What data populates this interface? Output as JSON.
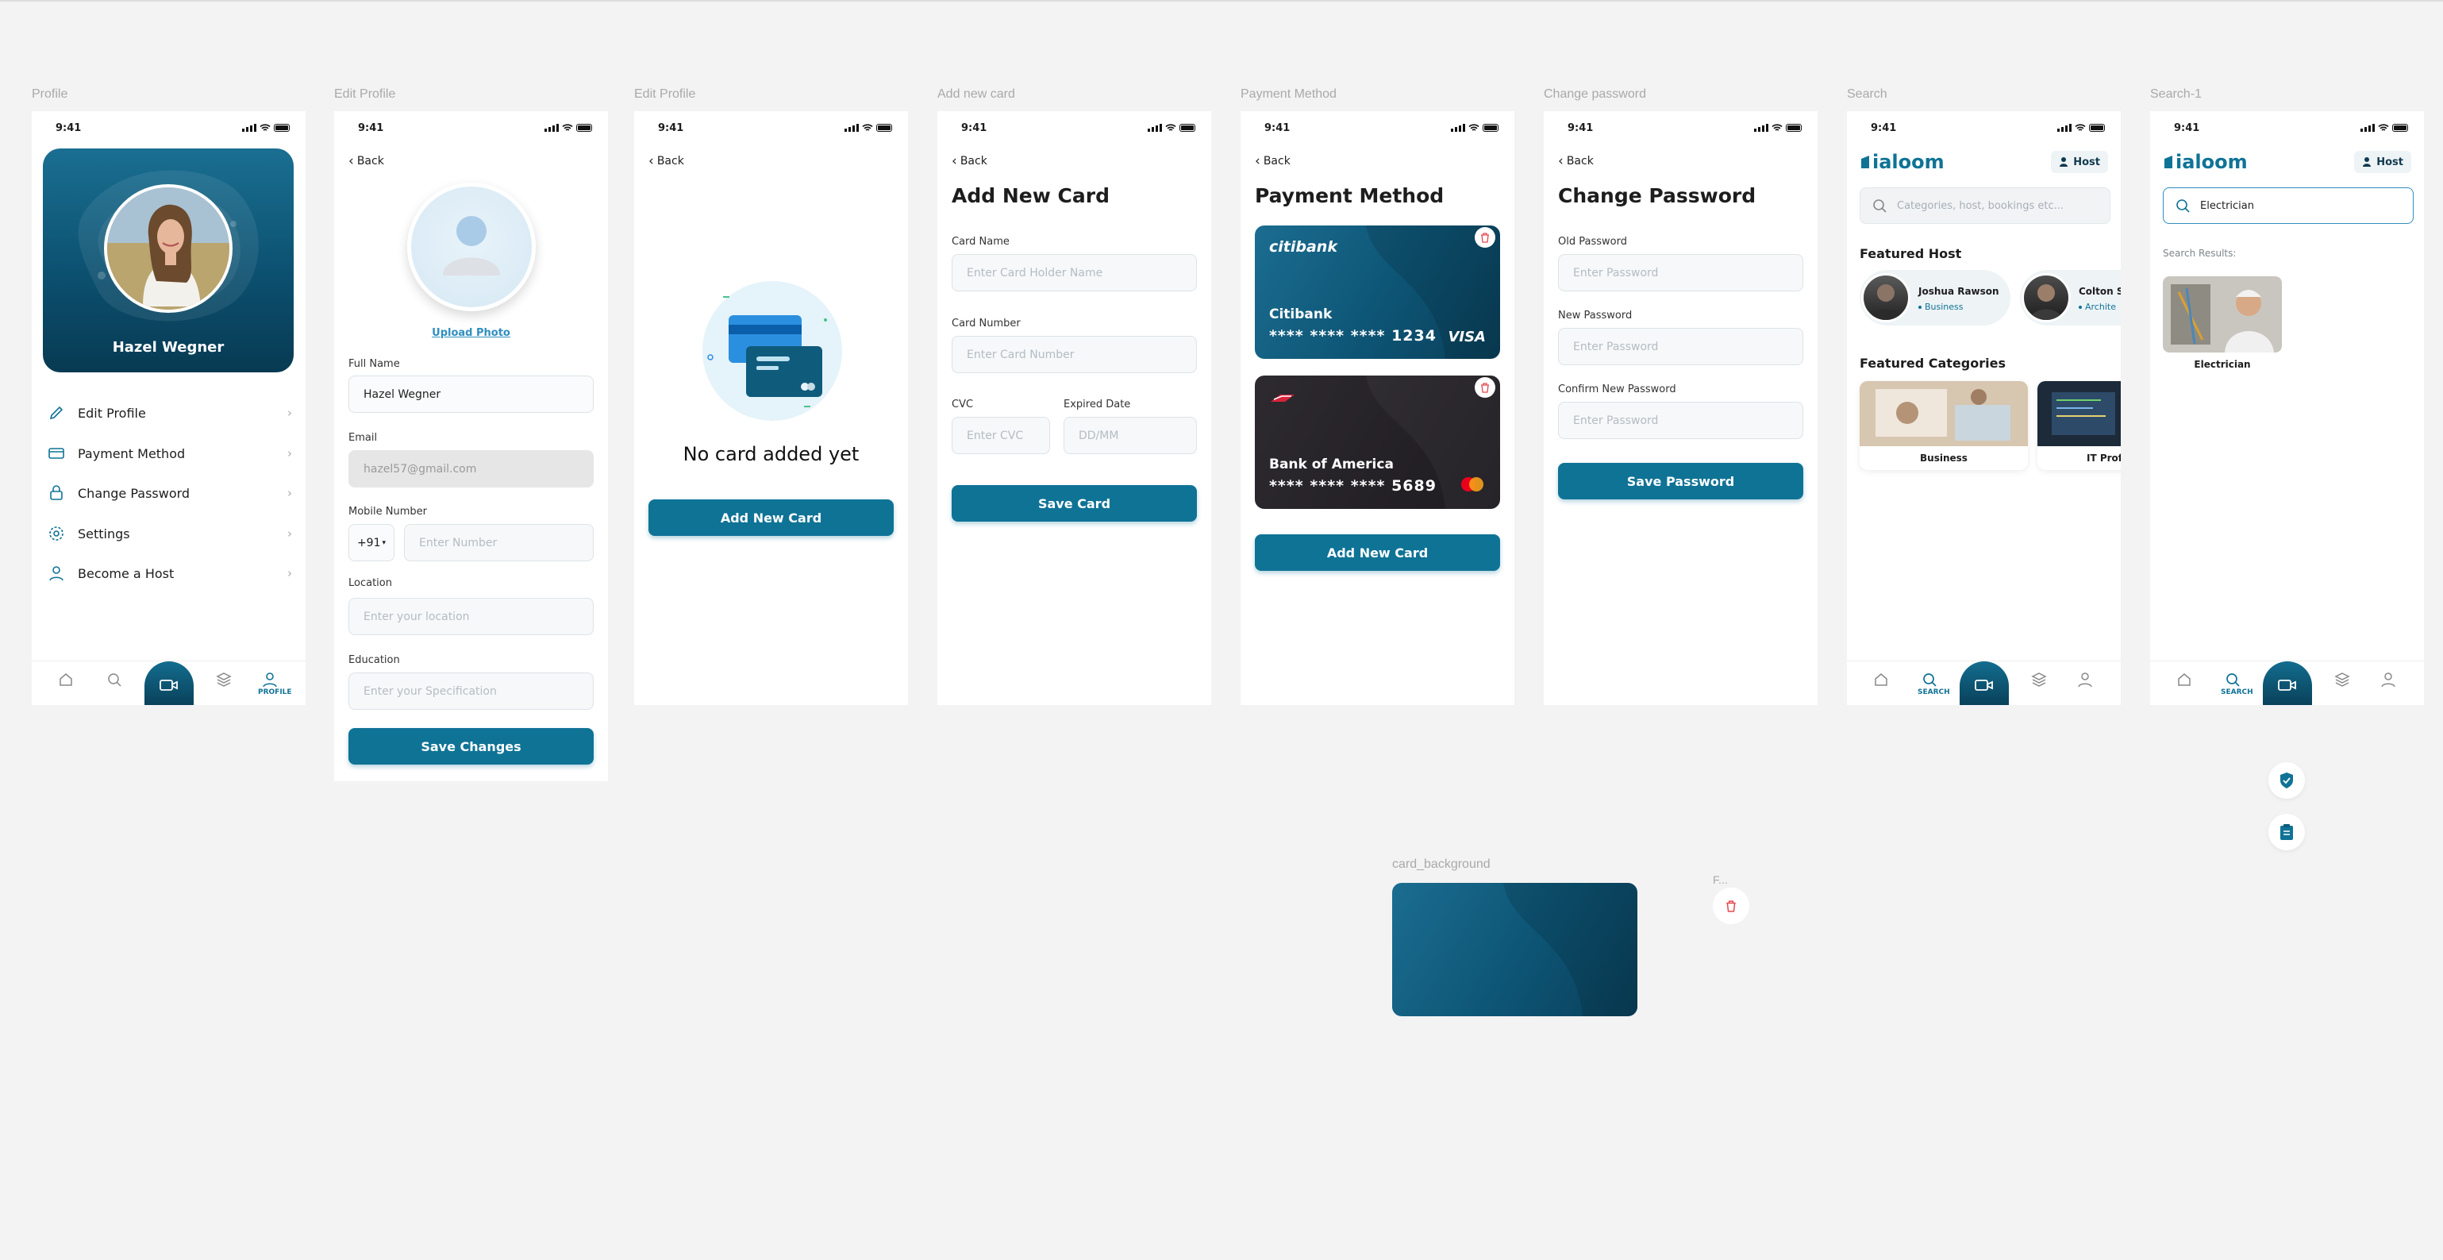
{
  "status": {
    "time": "9:41"
  },
  "frames": {
    "profile": "Profile",
    "edit_profile": "Edit Profile",
    "edit_profile_2": "Edit Profile",
    "add_new_card": "Add new card",
    "payment_method": "Payment Method",
    "change_password": "Change password",
    "search": "Search",
    "search_1": "Search-1",
    "card_background": "card_background",
    "f": "F..."
  },
  "profile": {
    "name": "Hazel Wegner",
    "menu": [
      {
        "label": "Edit Profile",
        "icon": "pencil-icon"
      },
      {
        "label": "Payment Method",
        "icon": "credit-card-icon"
      },
      {
        "label": "Change Password",
        "icon": "lock-icon"
      },
      {
        "label": "Settings",
        "icon": "gear-icon"
      },
      {
        "label": "Become a Host",
        "icon": "user-icon"
      }
    ],
    "active_tab": "PROFILE"
  },
  "edit_profile": {
    "back": "Back",
    "upload_photo": "Upload Photo",
    "full_name_label": "Full Name",
    "full_name_value": "Hazel Wegner",
    "email_label": "Email",
    "email_value": "hazel57@gmail.com",
    "mobile_label": "Mobile Number",
    "country_code": "+91",
    "mobile_placeholder": "Enter Number",
    "location_label": "Location",
    "location_placeholder": "Enter your location",
    "education_label": "Education",
    "education_placeholder": "Enter your Specification",
    "save": "Save Changes"
  },
  "no_card": {
    "back": "Back",
    "message": "No card added yet",
    "button": "Add New Card"
  },
  "add_card": {
    "back": "Back",
    "title": "Add New Card",
    "card_name_label": "Card Name",
    "card_name_placeholder": "Enter Card Holder Name",
    "card_number_label": "Card Number",
    "card_number_placeholder": "Enter Card Number",
    "cvc_label": "CVC",
    "cvc_placeholder": "Enter CVC",
    "expiry_label": "Expired Date",
    "expiry_placeholder": "DD/MM",
    "button": "Save Card"
  },
  "payment": {
    "back": "Back",
    "title": "Payment Method",
    "cards": [
      {
        "bank_logo": "citibank",
        "bank": "Citibank",
        "number": "**** **** **** 1234",
        "brand": "VISA"
      },
      {
        "bank": "Bank of America",
        "number": "**** **** **** 5689",
        "brand": "mastercard"
      }
    ],
    "button": "Add New Card"
  },
  "password": {
    "back": "Back",
    "title": "Change Password",
    "old_label": "Old Password",
    "new_label": "New Password",
    "confirm_label": "Confirm New Password",
    "placeholder": "Enter Password",
    "button": "Save Password"
  },
  "search": {
    "brand": "ialoom",
    "host_chip": "Host",
    "placeholder": "Categories, host, bookings etc...",
    "featured_host_title": "Featured Host",
    "hosts": [
      {
        "name": "Joshua Rawson",
        "tag": "Business"
      },
      {
        "name": "Colton S",
        "tag": "Archite"
      }
    ],
    "featured_categories_title": "Featured Categories",
    "categories": [
      "Business",
      "IT Profe"
    ],
    "active_tab": "SEARCH"
  },
  "search1": {
    "brand": "ialoom",
    "host_chip": "Host",
    "query": "Electrician",
    "results_label": "Search Results:",
    "result": "Electrician",
    "active_tab": "SEARCH"
  },
  "colors": {
    "primary": "#0f7396",
    "dark_teal": "#083d55",
    "danger": "#e5484d"
  }
}
